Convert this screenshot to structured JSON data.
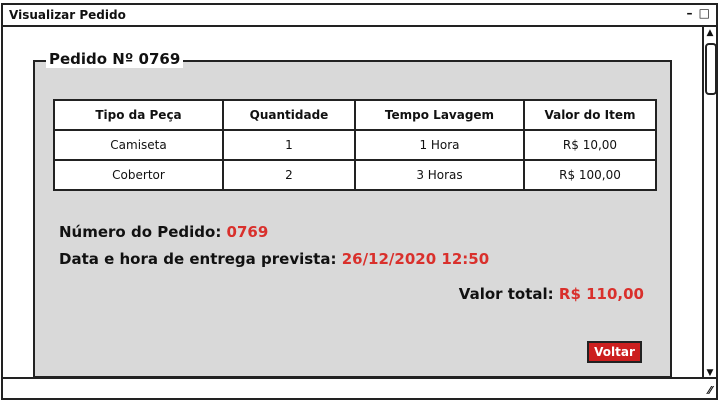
{
  "window": {
    "title": "Visualizar Pedido",
    "minimize": "–",
    "maximize": "□"
  },
  "panel": {
    "title": "Pedido Nº 0769"
  },
  "table": {
    "headers": [
      "Tipo da Peça",
      "Quantidade",
      "Tempo Lavagem",
      "Valor do Item"
    ],
    "rows": [
      [
        "Camiseta",
        "1",
        "1 Hora",
        "R$ 10,00"
      ],
      [
        "Cobertor",
        "2",
        "3 Horas",
        "R$ 100,00"
      ]
    ]
  },
  "order": {
    "number_label": "Número do Pedido:",
    "number_value": "0769",
    "delivery_label": "Data e hora de entrega prevista:",
    "delivery_value": "26/12/2020 12:50",
    "total_label": "Valor total:",
    "total_value": "R$ 110,00"
  },
  "actions": {
    "back_label": "Voltar"
  },
  "colors": {
    "accent": "#d9302c",
    "button": "#cc1f1f",
    "panel_bg": "#d9d9d9"
  }
}
